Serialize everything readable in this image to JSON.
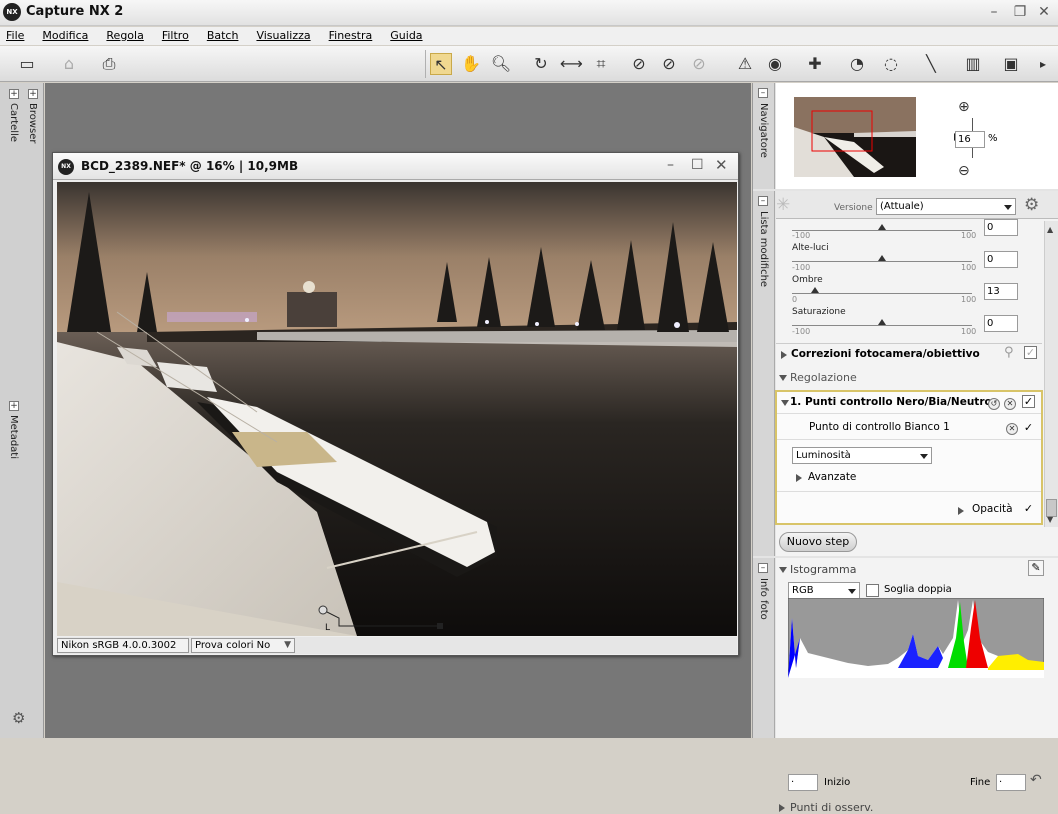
{
  "app": {
    "title": "Capture NX 2",
    "logo": "NX"
  },
  "menu": [
    "File",
    "Modifica",
    "Regola",
    "Filtro",
    "Batch",
    "Visualizza",
    "Finestra",
    "Guida"
  ],
  "left_tabs": {
    "folders": "Cartelle",
    "browser": "Browser",
    "metadata": "Metadati"
  },
  "document": {
    "title": "BCD_2389.NEF* @ 16% | 10,9MB",
    "profile": "Nikon sRGB 4.0.0.3002",
    "proof_colors": "Prova colori No",
    "point_label": "L"
  },
  "navigator": {
    "tab": "Navigatore",
    "zoom_value": "16",
    "zoom_unit": "%"
  },
  "edit_list": {
    "tab": "Lista modifiche",
    "version_label": "Versione",
    "version_value": "(Attuale)",
    "top_slider": {
      "min": "-100",
      "max": "100",
      "value": "0"
    },
    "sliders": [
      {
        "label": "Alte-luci",
        "min": "-100",
        "max": "100",
        "value": "0",
        "level": 0.5
      },
      {
        "label": "Ombre",
        "min": "0",
        "max": "100",
        "value": "13",
        "level": 0.13
      },
      {
        "label": "Saturazione",
        "min": "-100",
        "max": "100",
        "value": "0",
        "level": 0.5
      }
    ],
    "camera_corrections": "Correzioni fotocamera/obiettivo",
    "adjust_section": "Regolazione",
    "step_title": "1. Punti controllo Nero/Bia/Neutro",
    "control_point": "Punto di controllo Bianco 1",
    "channel": "Luminosità",
    "advanced": "Avanzate",
    "opacity": "Opacità",
    "new_step": "Nuovo step"
  },
  "photo_info": {
    "tab": "Info foto",
    "histogram_title": "Istogramma",
    "channel": "RGB",
    "dual_threshold": "Soglia doppia",
    "start_label": "Inizio",
    "end_label": "Fine",
    "watch_points": "Punti di osserv."
  },
  "icons": [
    "select-arrow-icon",
    "hand-icon",
    "zoom-icon",
    "rotate-icon",
    "straighten-icon",
    "crop-icon",
    "black-picker-icon",
    "white-picker-icon",
    "neutral-picker-icon",
    "red-eye-icon",
    "lasso-icon",
    "gear-icon"
  ]
}
